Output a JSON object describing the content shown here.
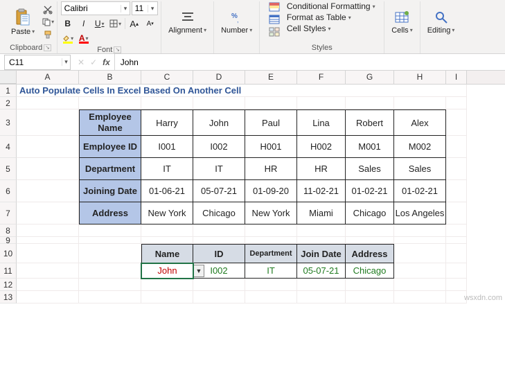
{
  "ribbon": {
    "clipboard": {
      "label": "Clipboard",
      "paste": "Paste"
    },
    "font": {
      "label": "Font",
      "name": "Calibri",
      "size": "11",
      "bold": "B",
      "italic": "I",
      "underline": "U",
      "grow": "A",
      "shrink": "A"
    },
    "alignment": {
      "label": "Alignment"
    },
    "number": {
      "label": "Number"
    },
    "styles": {
      "label": "Styles",
      "cond": "Conditional Formatting",
      "table": "Format as Table",
      "cell": "Cell Styles"
    },
    "cells": {
      "label": "Cells"
    },
    "editing": {
      "label": "Editing"
    }
  },
  "formula_bar": {
    "cell_ref": "C11",
    "formula": "John"
  },
  "columns": [
    "",
    "A",
    "B",
    "C",
    "D",
    "E",
    "F",
    "G",
    "H",
    "I"
  ],
  "row_labels": [
    "1",
    "2",
    "3",
    "4",
    "5",
    "6",
    "7",
    "8",
    "9",
    "10",
    "11",
    "12",
    "13"
  ],
  "title": "Auto Populate Cells In Excel Based On Another Cell",
  "table1": {
    "row_headers": [
      "Employee Name",
      "Employee ID",
      "Department",
      "Joining Date",
      "Address"
    ],
    "cols": [
      [
        "Harry",
        "I001",
        "IT",
        "01-06-21",
        "New York"
      ],
      [
        "John",
        "I002",
        "IT",
        "05-07-21",
        "Chicago"
      ],
      [
        "Paul",
        "H001",
        "HR",
        "01-09-20",
        "New York"
      ],
      [
        "Lina",
        "H002",
        "HR",
        "11-02-21",
        "Miami"
      ],
      [
        "Robert",
        "M001",
        "Sales",
        "01-02-21",
        "Chicago"
      ],
      [
        "Alex",
        "M002",
        "Sales",
        "01-02-21",
        "Los Angeles"
      ]
    ]
  },
  "table2": {
    "headers": [
      "Name",
      "ID",
      "Department",
      "Join Date",
      "Address"
    ],
    "values": [
      "John",
      "I002",
      "IT",
      "05-07-21",
      "Chicago"
    ]
  },
  "watermark": "wsxdn.com"
}
